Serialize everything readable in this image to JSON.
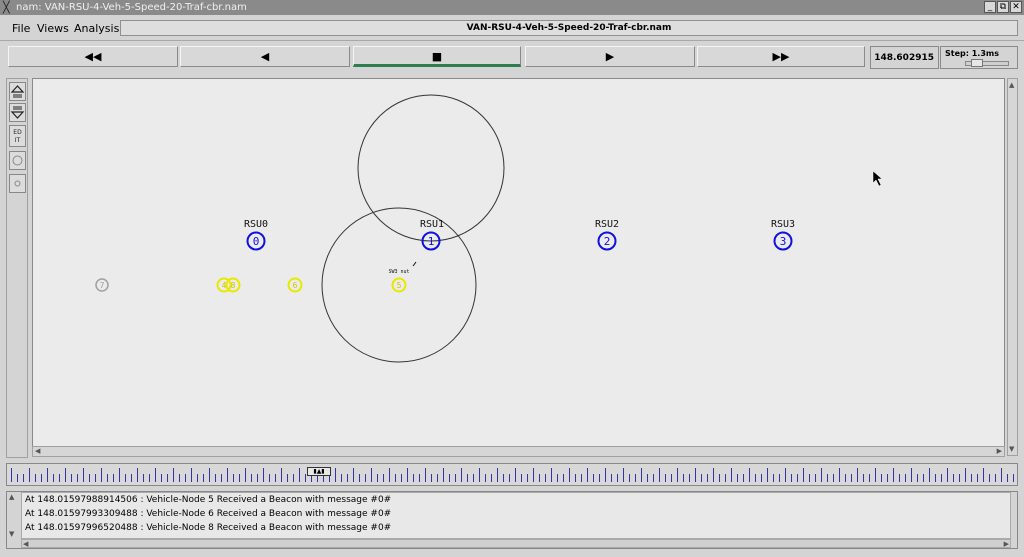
{
  "window": {
    "title": "nam: VAN-RSU-4-Veh-5-Speed-20-Traf-cbr.nam",
    "buttons": [
      "_",
      "⧉",
      "✕"
    ]
  },
  "menu": {
    "file": "File",
    "views": "Views",
    "analysis": "Analysis",
    "filename": "VAN-RSU-4-Veh-5-Speed-20-Traf-cbr.nam"
  },
  "controls": {
    "rewind": "◀◀",
    "back": "◀",
    "stop": "■",
    "play": "▶",
    "fast_forward": "▶▶",
    "time": "148.602915",
    "step": "Step: 1.3ms"
  },
  "tools": {
    "edit": "ED IT"
  },
  "scene": {
    "rsus": [
      {
        "label": "RSU0",
        "id": "0"
      },
      {
        "label": "RSU1",
        "id": "1"
      },
      {
        "label": "RSU2",
        "id": "2"
      },
      {
        "label": "RSU3",
        "id": "3"
      }
    ],
    "vehicles": [
      {
        "id": "7",
        "state": "inactive"
      },
      {
        "id": "4",
        "state": "active"
      },
      {
        "id": "8",
        "state": "active"
      },
      {
        "id": "6",
        "state": "active"
      },
      {
        "id": "5",
        "state": "active"
      }
    ],
    "packet_label": "SW3 nut",
    "colors": {
      "rsu": "#1010e0",
      "vehicle": "#e8e800",
      "inactive": "#a0a0a0",
      "range": "#333333"
    }
  },
  "timeline": {
    "marker": "▮▲▮"
  },
  "log": {
    "lines": [
      "At 148.01597988914506 : Vehicle-Node 5 Received a Beacon with message #0#",
      "At 148.01597993309488 : Vehicle-Node 6 Received a Beacon with message #0#",
      "At 148.01597996520488 : Vehicle-Node 8 Received a Beacon with message #0#"
    ]
  }
}
